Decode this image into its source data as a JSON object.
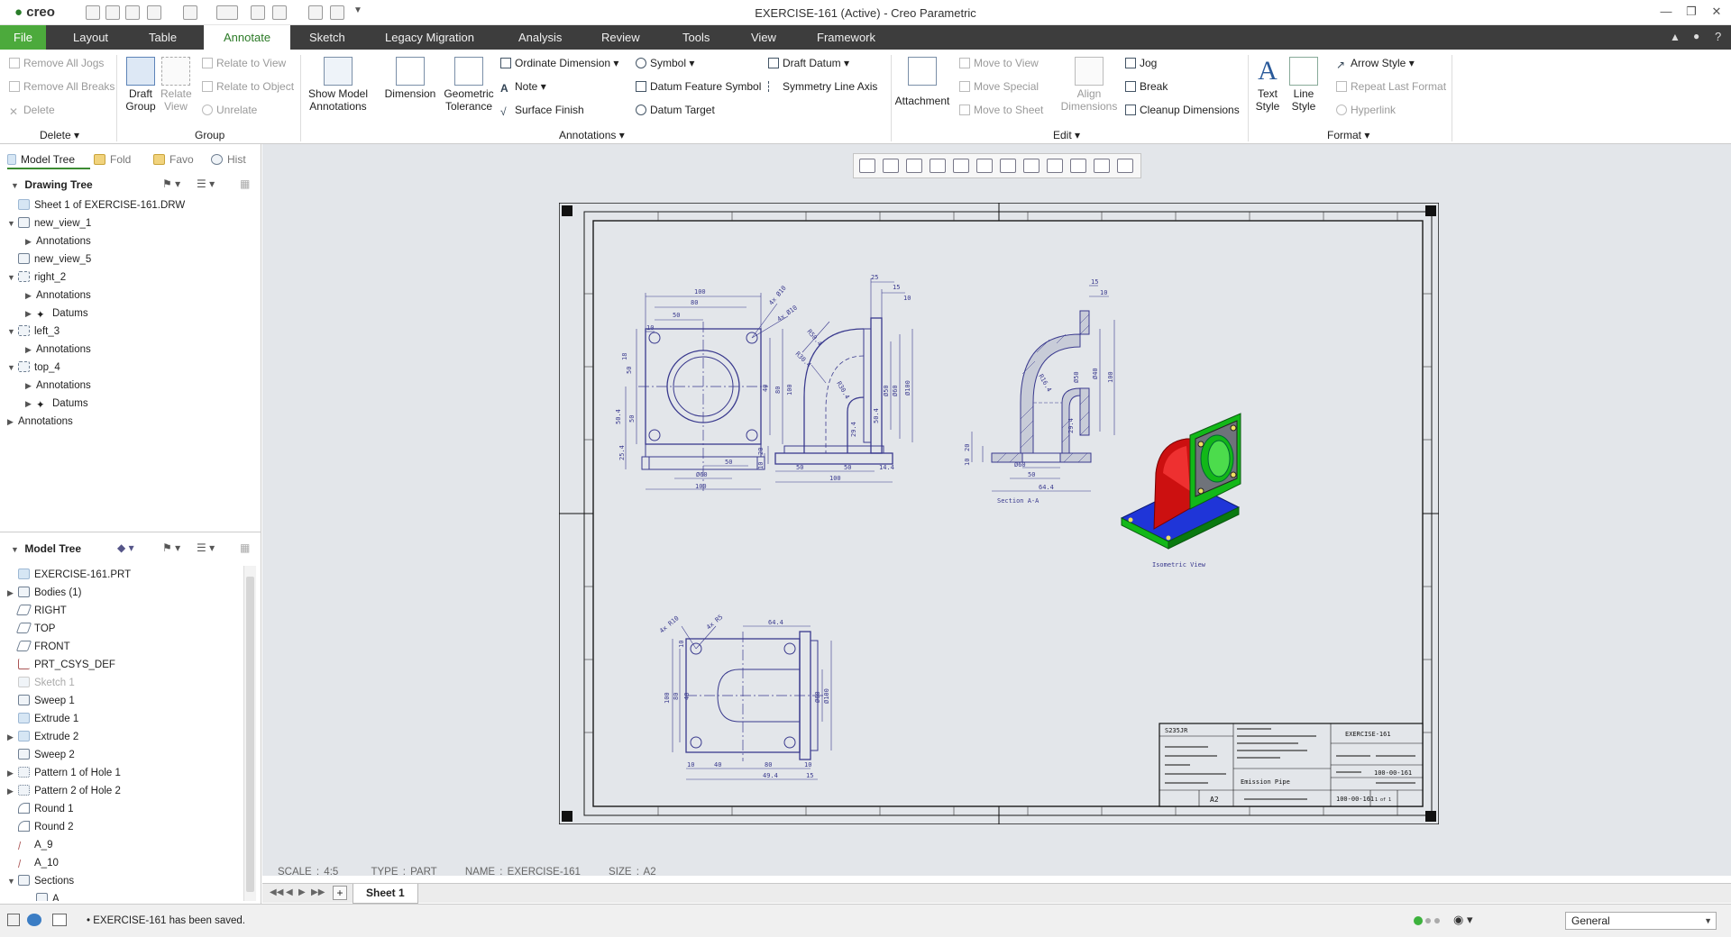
{
  "titlebar": {
    "logo": "creo",
    "title": "EXERCISE-161 (Active) - Creo Parametric"
  },
  "tabs": [
    "File",
    "Layout",
    "Table",
    "Annotate",
    "Sketch",
    "Legacy Migration",
    "Analysis",
    "Review",
    "Tools",
    "View",
    "Framework"
  ],
  "active_tab": "Annotate",
  "ribbon": {
    "delete_group": {
      "items": [
        "Remove All Jogs",
        "Remove All Breaks",
        "Delete"
      ],
      "label": "Delete"
    },
    "group_group": {
      "draft_group": "Draft Group",
      "relate_view": "Relate View",
      "relate_to_view": "Relate to View",
      "relate_to_object": "Relate to Object",
      "unrelate": "Unrelate",
      "label": "Group"
    },
    "annotations_group": {
      "show_model_annotations": "Show Model Annotations",
      "dimension": "Dimension",
      "geometric_tolerance": "Geometric Tolerance",
      "ordinate_dimension": "Ordinate Dimension",
      "note": "Note",
      "surface_finish": "Surface Finish",
      "symbol": "Symbol",
      "datum_feature_symbol": "Datum Feature Symbol",
      "datum_target": "Datum Target",
      "draft_datum": "Draft Datum",
      "symmetry_line_axis": "Symmetry Line Axis",
      "label": "Annotations"
    },
    "edit_group": {
      "attachment": "Attachment",
      "move_to_view": "Move to View",
      "move_special": "Move Special",
      "move_to_sheet": "Move to Sheet",
      "align_dimensions": "Align Dimensions",
      "jog": "Jog",
      "break": "Break",
      "cleanup_dimensions": "Cleanup Dimensions",
      "label": "Edit"
    },
    "format_group": {
      "text_style": "Text Style",
      "line_style": "Line Style",
      "arrow_style": "Arrow Style",
      "repeat_last_format": "Repeat Last Format",
      "hyperlink": "Hyperlink",
      "label": "Format"
    }
  },
  "left_panel": {
    "tabs": [
      "Model Tree",
      "Fold",
      "Favo",
      "Hist"
    ],
    "drawing_tree": {
      "title": "Drawing Tree",
      "items": [
        "Sheet 1 of EXERCISE-161.DRW",
        "new_view_1",
        "Annotations",
        "new_view_5",
        "right_2",
        "Annotations",
        "Datums",
        "left_3",
        "Annotations",
        "top_4",
        "Annotations",
        "Datums",
        "Annotations"
      ]
    },
    "model_tree": {
      "title": "Model Tree",
      "items": [
        "EXERCISE-161.PRT",
        "Bodies (1)",
        "RIGHT",
        "TOP",
        "FRONT",
        "PRT_CSYS_DEF",
        "Sketch 1",
        "Sweep 1",
        "Extrude 1",
        "Extrude 2",
        "Sweep 2",
        "Pattern 1 of Hole 1",
        "Pattern 2 of Hole 2",
        "Round 1",
        "Round 2",
        "A_9",
        "A_10",
        "Sections",
        "A"
      ]
    }
  },
  "drawing": {
    "status": {
      "scale": "SCALE : 4:5",
      "type": "TYPE : PART",
      "name": "NAME : EXERCISE-161",
      "size": "SIZE : A2"
    },
    "labels": {
      "section_label": "Section A-A",
      "iso_label": "Isometric View"
    },
    "title_block": {
      "company": "S235JR",
      "exercise": "EXERCISE-161",
      "code": "100-00-161",
      "size": "A2",
      "name": "Emission Pipe",
      "code2": "100-00-161",
      "sheet": "1 of 1"
    },
    "front_dims": [
      "100",
      "80",
      "50",
      "10",
      "18",
      "50",
      "40",
      "80",
      "100",
      "50.4",
      "50",
      "25.4",
      "50",
      "Ø60",
      "100",
      "4x Ø10",
      "4x Ø10"
    ],
    "side_dims": [
      "25",
      "15",
      "10",
      "R50.4",
      "R30.4",
      "R30.4",
      "Ø50",
      "Ø60",
      "Ø100",
      "50.4",
      "29.4",
      "20",
      "10",
      "50",
      "50",
      "14.4",
      "100"
    ],
    "section_dims": [
      "15",
      "10",
      "Ø40",
      "Ø50",
      "100",
      "R16.4",
      "29.4",
      "20",
      "10",
      "Ø60",
      "50",
      "64.4"
    ],
    "top_dims": [
      "4x R10",
      "4x R5",
      "64.4",
      "10",
      "100",
      "80",
      "40",
      "Ø60",
      "Ø100",
      "10",
      "40",
      "80",
      "49.4",
      "10",
      "15"
    ],
    "sheet_tab": "Sheet 1"
  },
  "statusbar": {
    "message": "EXERCISE-161 has been saved.",
    "filter": "General"
  },
  "colors": {
    "accent": "#4caa3c",
    "tabbar": "#3d3d3d",
    "canvas": "#e3e6ea",
    "drawing_line": "#3a3a8e",
    "iso_red": "#cc1010",
    "iso_green": "#12b818",
    "iso_blue": "#1f35d8"
  }
}
